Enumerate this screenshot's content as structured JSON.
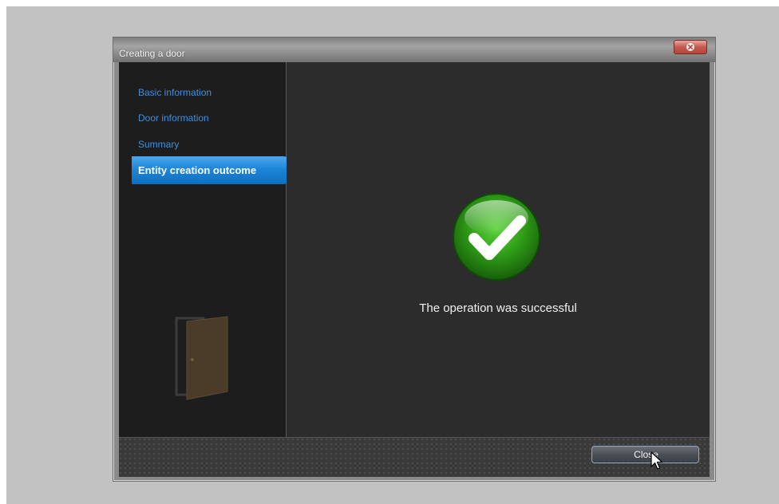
{
  "window": {
    "title": "Creating a door"
  },
  "sidebar": {
    "items": [
      {
        "label": "Basic information",
        "active": false
      },
      {
        "label": "Door information",
        "active": false
      },
      {
        "label": "Summary",
        "active": false
      },
      {
        "label": "Entity creation outcome",
        "active": true
      }
    ]
  },
  "content": {
    "status_icon": "checkmark-icon",
    "message": "The operation was successful"
  },
  "footer": {
    "close_label": "Close"
  },
  "colors": {
    "nav_link": "#3e8fde",
    "active_nav": "#1e86d8",
    "success_green": "#2e9a17"
  }
}
